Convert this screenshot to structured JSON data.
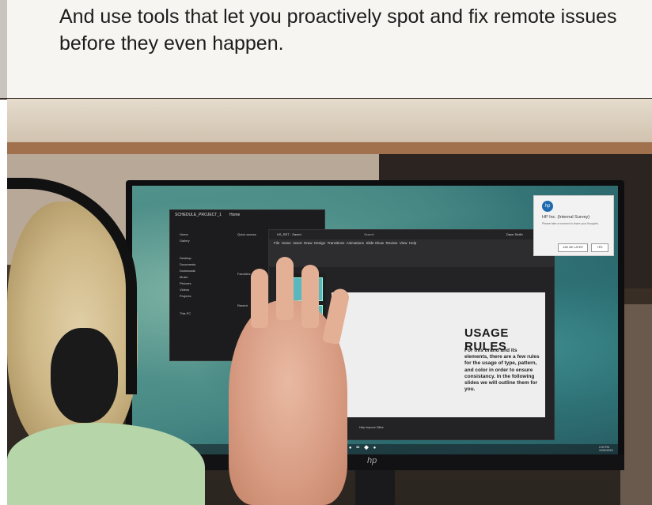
{
  "header": {
    "headline": "And use tools that let you proactively spot and fix remote issues before they even happen."
  },
  "photo": {
    "file_explorer": {
      "window_title": "SCHEDULE_PROJECT_1",
      "tab_label": "Home",
      "nav_items": [
        "Home",
        "Gallery",
        "Desktop",
        "Documents",
        "Downloads",
        "Music",
        "Pictures",
        "Videos",
        "Projects",
        "This PC"
      ],
      "content_items": [
        "Quick access",
        "Favorites",
        "Recent"
      ]
    },
    "powerpoint": {
      "file_name": "HS_RET - Saved",
      "search_placeholder": "Search",
      "user_name": "Dave Smith",
      "menu_items": [
        "File",
        "Home",
        "Insert",
        "Draw",
        "Design",
        "Transitions",
        "Animations",
        "Slide Show",
        "Review",
        "View",
        "Help"
      ],
      "slide": {
        "title": "USAGE RULES",
        "body": "For this brand and its elements, there are a few rules for the usage of type, pattern, and color in order to ensure consistancy. In the following slides we will outline them for you."
      },
      "status_text": "Help Improve Office"
    },
    "survey_popup": {
      "logo_text": "hp",
      "title": "HP Inc. (Internal Survey)",
      "description": "Please take a moment to share your thoughts.",
      "ask_later_label": "ASK ME LATER",
      "yes_label": "YES"
    },
    "taskbar": {
      "icons": [
        "start-icon",
        "search-icon",
        "taskview-icon",
        "files-icon",
        "edge-icon",
        "mail-icon",
        "store-icon",
        "teams-icon"
      ],
      "time": "2:33 PM",
      "date": "10/02/2023"
    },
    "monitor_brand": "hp"
  },
  "colors": {
    "headline": "#1c1c1c",
    "slide_bg": "#eeeeee",
    "hp_blue": "#1e6ab0",
    "wallpaper": "#2f6e72"
  }
}
